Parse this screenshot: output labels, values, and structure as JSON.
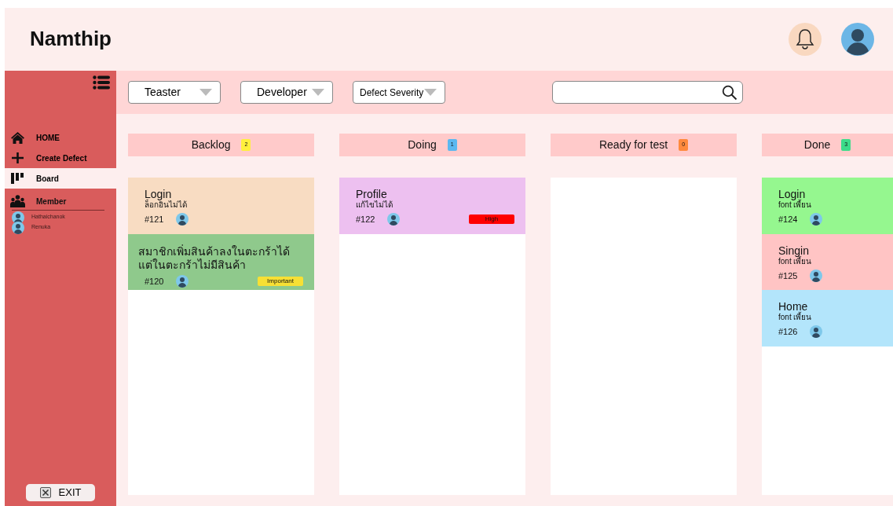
{
  "app": {
    "title": "Namthip"
  },
  "sidebar": {
    "items": [
      {
        "label": "HOME",
        "selected": false
      },
      {
        "label": "Create Defect",
        "selected": false
      },
      {
        "label": "Board",
        "selected": true
      }
    ],
    "members": {
      "label": "Member",
      "people": [
        "Hathaichanok",
        "Renuka"
      ]
    },
    "exit": "EXIT"
  },
  "filters": [
    {
      "label": "Teaster"
    },
    {
      "label": "Developer"
    },
    {
      "label": "Defect Severity"
    }
  ],
  "columns": [
    {
      "title": "Backlog",
      "count": "2",
      "color": "#fff03c",
      "cards": [
        {
          "title": "Login",
          "subtitle": "ล็อกอินไม่ได้",
          "id": "#121",
          "color": "#f8dcc2"
        },
        {
          "title": "สมาชิกเพิ่มสินค้าลงในตะกร้าได้ แต่ในตะกร้าไม่มีสินค้า",
          "id": "#120",
          "color": "#8fc98c",
          "tag": {
            "label": "Important",
            "color": "#f7e034"
          }
        }
      ]
    },
    {
      "title": "Doing",
      "count": "1",
      "color": "#5bb8f0",
      "cards": [
        {
          "title": "Profile",
          "subtitle": "แก้ไขไม่ได้",
          "id": "#122",
          "color": "#edc0f0",
          "tag": {
            "label": "High",
            "color": "#ff0000"
          }
        }
      ]
    },
    {
      "title": "Ready for test",
      "count": "0",
      "color": "#ff8a3d"
    },
    {
      "title": "Done",
      "count": "3",
      "color": "#3ddc8a",
      "cards": [
        {
          "title": "Login",
          "subtitle": "font เพี้ยน",
          "id": "#124",
          "color": "#95f78f"
        },
        {
          "title": "Singin",
          "subtitle": "font เพี้ยน",
          "id": "#125",
          "color": "#ffc4c4"
        },
        {
          "title": "Home",
          "subtitle": "font เพี้ยน",
          "id": "#126",
          "color": "#b3e5fb"
        }
      ]
    }
  ]
}
